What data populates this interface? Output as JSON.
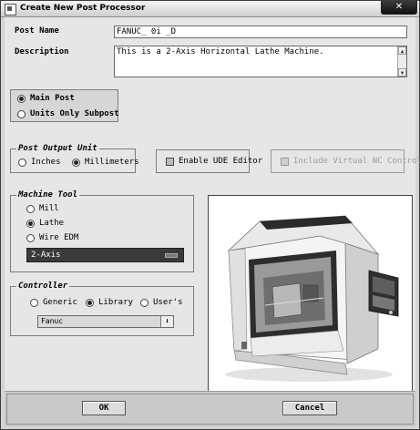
{
  "window": {
    "title": "Create New Post Processor",
    "close_glyph": "✕"
  },
  "post_name": {
    "label": "Post Name",
    "value": "FANUC_ 0i _D"
  },
  "description": {
    "label": "Description",
    "value": "This is a 2-Axis Horizontal Lathe Machine."
  },
  "post_type": {
    "options": [
      {
        "label": "Main Post",
        "selected": true
      },
      {
        "label": "Units Only Subpost",
        "selected": false
      }
    ]
  },
  "output_unit": {
    "legend": "Post Output Unit",
    "options": [
      {
        "label": "Inches",
        "selected": false
      },
      {
        "label": "Millimeters",
        "selected": true
      }
    ]
  },
  "ude": {
    "label": "Enable UDE Editor",
    "checked": false
  },
  "virtual_nc": {
    "label": "Include Virtual NC Controller",
    "checked": false,
    "enabled": false
  },
  "machine_tool": {
    "legend": "Machine Tool",
    "options": [
      {
        "label": "Mill",
        "selected": false
      },
      {
        "label": "Lathe",
        "selected": true
      },
      {
        "label": "Wire EDM",
        "selected": false
      }
    ],
    "axis_value": "2-Axis"
  },
  "controller": {
    "legend": "Controller",
    "options": [
      {
        "label": "Generic",
        "selected": false
      },
      {
        "label": "Library",
        "selected": true
      },
      {
        "label": "User's",
        "selected": false
      }
    ],
    "library_value": "Fanuc",
    "dropdown_glyph": "⬇"
  },
  "buttons": {
    "ok": "OK",
    "cancel": "Cancel"
  },
  "icons": {
    "scroll_up": "▲",
    "scroll_down": "▼"
  }
}
